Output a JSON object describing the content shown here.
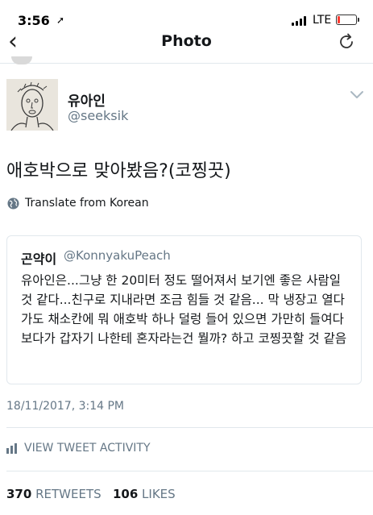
{
  "status_bar": {
    "time": "3:56",
    "location_glyph": "➚",
    "network": "LTE",
    "battery_level": 0.15
  },
  "nav": {
    "back_glyph": "‹",
    "title": "Photo"
  },
  "tweet": {
    "author_name": "유아인",
    "author_handle": "@seeksik",
    "text": "애호박으로 맞아봤음?(코찡끗)",
    "translate_label": "Translate from Korean"
  },
  "quote": {
    "author_name": "곤약이",
    "author_handle": "@KonnyakuPeach",
    "text": "유아인은...그냥 한 20미터 정도 떨어져서 보기엔 좋은 사람일 것 같다...친구로 지내라면 조금 힘들 것 같음... 막 냉장고 열다가도 채소칸에 뭐 애호박 하나 덜렁 들어 있으면 가만히 들여다보다가 갑자기 나한테 혼자라는건 뭘까? 하고 코찡끗할 것 같음"
  },
  "meta": {
    "timestamp": "18/11/2017, 3:14 PM",
    "activity_label": "VIEW TWEET ACTIVITY",
    "retweets_count": "370",
    "retweets_label": "RETWEETS",
    "likes_count": "106",
    "likes_label": "LIKES"
  },
  "colors": {
    "primary_text": "#14171a",
    "secondary_text": "#657786",
    "divider": "#e1e8ed",
    "battery_low": "#ff3b30"
  }
}
